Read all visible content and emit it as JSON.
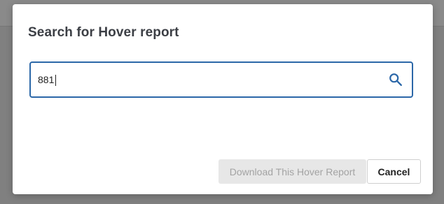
{
  "dialog": {
    "title": "Search for Hover report",
    "search": {
      "value": "881",
      "icon": "search-icon"
    },
    "buttons": {
      "download_label": "Download This Hover Report",
      "cancel_label": "Cancel"
    }
  },
  "colors": {
    "accent": "#2b67a8",
    "title_text": "#3c3f45",
    "disabled_button_bg": "#e7e7e7",
    "disabled_button_text": "#a3a3a3",
    "overlay": "#808080"
  }
}
